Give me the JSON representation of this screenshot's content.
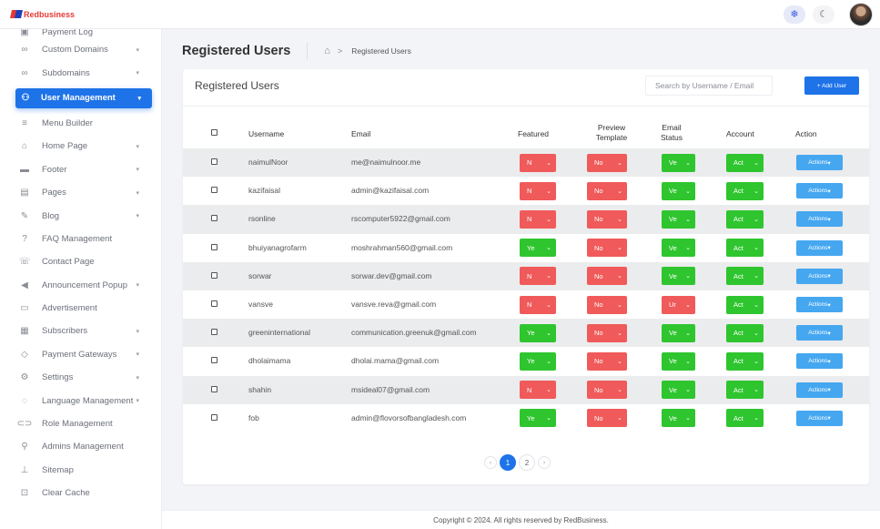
{
  "brand": {
    "name": "Redbusiness"
  },
  "topbar": {
    "light_icon": "❄",
    "dark_icon": "☾"
  },
  "sidebar": {
    "items": [
      {
        "label": "Payment Log",
        "icon": "receipt-icon",
        "glyph": "▣",
        "caret": false,
        "active": false,
        "partial": true
      },
      {
        "label": "Custom Domains",
        "icon": "link-icon",
        "glyph": "∞",
        "caret": true,
        "active": false
      },
      {
        "label": "Subdomains",
        "icon": "link-icon",
        "glyph": "∞",
        "caret": true,
        "active": false
      },
      {
        "label": "User Management",
        "icon": "users-icon",
        "glyph": "⚇",
        "caret": true,
        "active": true
      },
      {
        "label": "Menu Builder",
        "icon": "menu-icon",
        "glyph": "≡",
        "caret": false,
        "active": false
      },
      {
        "label": "Home Page",
        "icon": "home-icon",
        "glyph": "⌂",
        "caret": true,
        "active": false
      },
      {
        "label": "Footer",
        "icon": "footer-icon",
        "glyph": "▬",
        "caret": true,
        "active": false
      },
      {
        "label": "Pages",
        "icon": "page-icon",
        "glyph": "▤",
        "caret": true,
        "active": false
      },
      {
        "label": "Blog",
        "icon": "blog-icon",
        "glyph": "✎",
        "caret": true,
        "active": false
      },
      {
        "label": "FAQ Management",
        "icon": "question-icon",
        "glyph": "?",
        "caret": false,
        "active": false
      },
      {
        "label": "Contact Page",
        "icon": "phone-icon",
        "glyph": "☏",
        "caret": false,
        "active": false
      },
      {
        "label": "Announcement Popup",
        "icon": "megaphone-icon",
        "glyph": "◀",
        "caret": true,
        "active": false
      },
      {
        "label": "Advertisement",
        "icon": "ad-icon",
        "glyph": "▭",
        "caret": false,
        "active": false
      },
      {
        "label": "Subscribers",
        "icon": "subscribers-icon",
        "glyph": "▦",
        "caret": true,
        "active": false
      },
      {
        "label": "Payment Gateways",
        "icon": "payment-icon",
        "glyph": "◇",
        "caret": true,
        "active": false
      },
      {
        "label": "Settings",
        "icon": "gear-icon",
        "glyph": "⚙",
        "caret": true,
        "active": false
      },
      {
        "label": "Language Management",
        "icon": "language-icon",
        "glyph": "◌",
        "caret": true,
        "active": false
      },
      {
        "label": "Role Management",
        "icon": "role-icon",
        "glyph": "⊂⊃",
        "caret": false,
        "active": false
      },
      {
        "label": "Admins Management",
        "icon": "admin-icon",
        "glyph": "⚲",
        "caret": false,
        "active": false
      },
      {
        "label": "Sitemap",
        "icon": "sitemap-icon",
        "glyph": "⊥",
        "caret": false,
        "active": false
      },
      {
        "label": "Clear Cache",
        "icon": "cache-icon",
        "glyph": "⊡",
        "caret": false,
        "active": false
      }
    ]
  },
  "header": {
    "title": "Registered Users",
    "breadcrumb": "Registered Users"
  },
  "card": {
    "title": "Registered Users",
    "search_placeholder": "Search by Username / Email",
    "add_button": "+ Add User"
  },
  "table": {
    "headers": {
      "username": "Username",
      "email": "Email",
      "featured": "Featured",
      "preview1": "Preview",
      "preview2": "Template",
      "status1": "Email",
      "status2": "Status",
      "account": "Account",
      "action": "Action"
    },
    "rows": [
      {
        "username": "naimulNoor",
        "email": "me@naimulnoor.me",
        "featured": "N",
        "preview": "No",
        "email_status": "Ve",
        "account": "Act",
        "action": "Actions"
      },
      {
        "username": "kazifaisal",
        "email": "admin@kazifaisal.com",
        "featured": "N",
        "preview": "No",
        "email_status": "Ve",
        "account": "Act",
        "action": "Actions"
      },
      {
        "username": "rsonline",
        "email": "rscomputer5922@gmail.com",
        "featured": "N",
        "preview": "No",
        "email_status": "Ve",
        "account": "Act",
        "action": "Actions"
      },
      {
        "username": "bhuiyanagrofarm",
        "email": "moshrahman560@gmail.com",
        "featured": "Ye",
        "preview": "No",
        "email_status": "Ve",
        "account": "Act",
        "action": "Actions"
      },
      {
        "username": "sorwar",
        "email": "sorwar.dev@gmail.com",
        "featured": "N",
        "preview": "No",
        "email_status": "Ve",
        "account": "Act",
        "action": "Actions"
      },
      {
        "username": "vansve",
        "email": "vansve.reva@gmail.com",
        "featured": "N",
        "preview": "No",
        "email_status": "Ur",
        "account": "Act",
        "action": "Actions"
      },
      {
        "username": "greeninternational",
        "email": "communication.greenuk@gmail.com",
        "featured": "Ye",
        "preview": "No",
        "email_status": "Ve",
        "account": "Act",
        "action": "Actions"
      },
      {
        "username": "dholaimama",
        "email": "dholai.mama@gmail.com",
        "featured": "Ye",
        "preview": "No",
        "email_status": "Ve",
        "account": "Act",
        "action": "Actions"
      },
      {
        "username": "shahin",
        "email": "msideal07@gmail.com",
        "featured": "N",
        "preview": "No",
        "email_status": "Ve",
        "account": "Act",
        "action": "Actions"
      },
      {
        "username": "fob",
        "email": "admin@flovorsofbangladesh.com",
        "featured": "Ye",
        "preview": "No",
        "email_status": "Ve",
        "account": "Act",
        "action": "Actions"
      }
    ]
  },
  "status_colors": {
    "negative": "#f05a5a",
    "positive": "#2fc52f",
    "primary": "#1e73e8",
    "action": "#45a7f0"
  },
  "pagination": {
    "prev": "‹",
    "pages": [
      "1",
      "2"
    ],
    "current": "1",
    "next": "›"
  },
  "footer": {
    "text": "Copyright © 2024. All rights reserved by RedBusiness."
  }
}
